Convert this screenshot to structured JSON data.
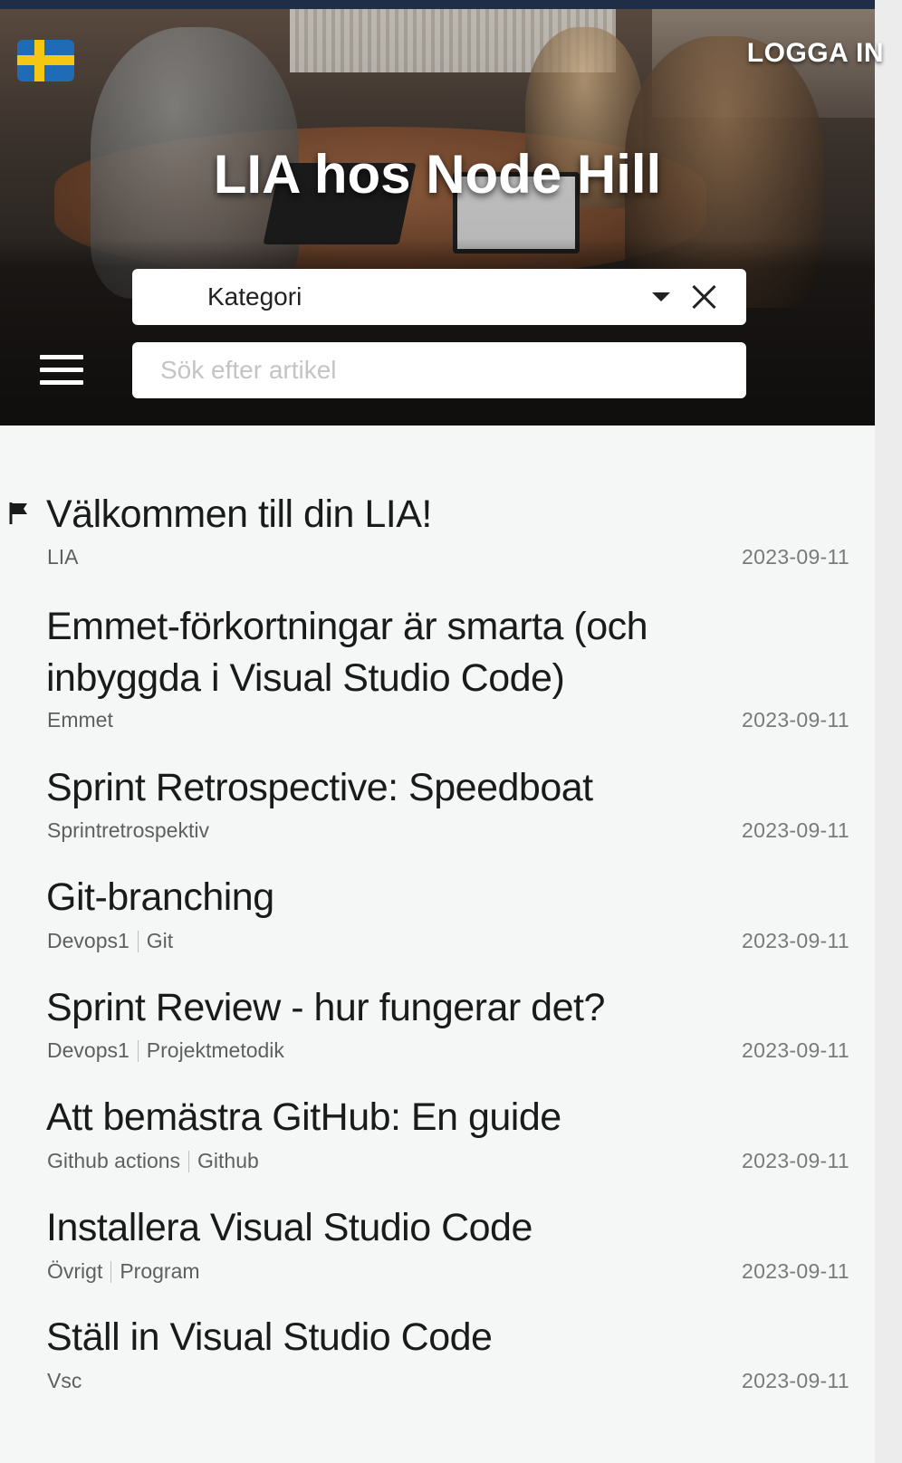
{
  "header": {
    "language_flag": "swedish-flag-icon",
    "login_label": "LOGGA IN",
    "title": "LIA hos Node Hill"
  },
  "filters": {
    "category_label": "Kategori",
    "search_placeholder": "Sök efter artikel"
  },
  "articles": [
    {
      "title": "Välkommen till din LIA!",
      "tags": [
        "LIA"
      ],
      "date": "2023-09-11",
      "pinned": true
    },
    {
      "title": "Emmet-förkortningar är smarta (och inbyggda i Visual Studio Code)",
      "tags": [
        "Emmet"
      ],
      "date": "2023-09-11",
      "pinned": false
    },
    {
      "title": "Sprint Retrospective: Speedboat",
      "tags": [
        "Sprintretrospektiv"
      ],
      "date": "2023-09-11",
      "pinned": false
    },
    {
      "title": "Git-branching",
      "tags": [
        "Devops1",
        "Git"
      ],
      "date": "2023-09-11",
      "pinned": false
    },
    {
      "title": "Sprint Review - hur fungerar det?",
      "tags": [
        "Devops1",
        "Projektmetodik"
      ],
      "date": "2023-09-11",
      "pinned": false
    },
    {
      "title": "Att bemästra GitHub: En guide",
      "tags": [
        "Github actions",
        "Github"
      ],
      "date": "2023-09-11",
      "pinned": false
    },
    {
      "title": "Installera Visual Studio Code",
      "tags": [
        "Övrigt",
        "Program"
      ],
      "date": "2023-09-11",
      "pinned": false
    },
    {
      "title": "Ställ in Visual Studio Code",
      "tags": [
        "Vsc"
      ],
      "date": "2023-09-11",
      "pinned": false
    }
  ]
}
